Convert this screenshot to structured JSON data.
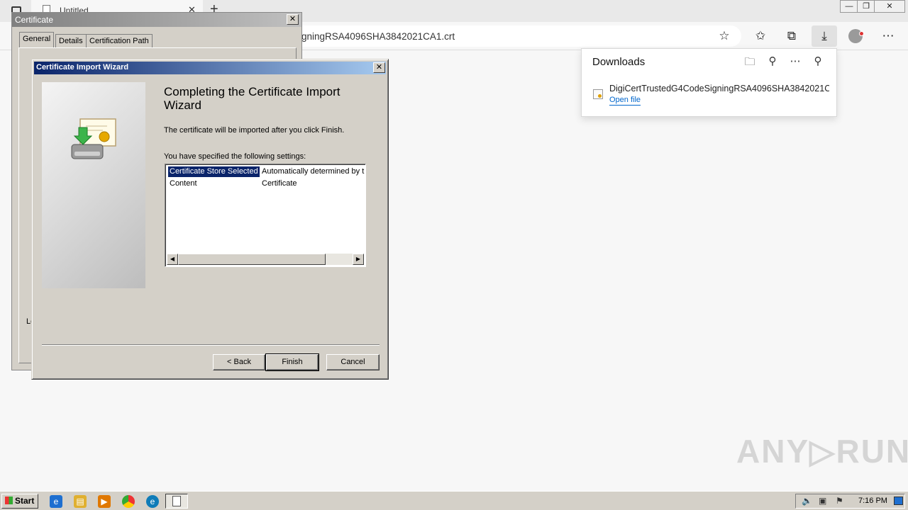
{
  "browser": {
    "tab_title": "Untitled",
    "tab_close": "✕",
    "new_tab": "+",
    "address": "igningRSA4096SHA3842021CA1.crt",
    "window_controls": [
      "—",
      "❐",
      "✕"
    ]
  },
  "downloads": {
    "title": "Downloads",
    "file_name": "DigiCertTrustedG4CodeSigningRSA4096SHA3842021C...",
    "open_file": "Open file"
  },
  "certificate_dialog": {
    "title": "Certificate",
    "close": "✕",
    "tabs": [
      "General",
      "Details",
      "Certification Path"
    ],
    "partial_text": "Le"
  },
  "wizard": {
    "title": "Certificate Import Wizard",
    "close": "✕",
    "heading": "Completing the Certificate Import Wizard",
    "text1": "The certificate will be imported after you click Finish.",
    "text2": "You have specified the following settings:",
    "settings": [
      {
        "name": "Certificate Store Selected",
        "value": "Automatically determined by t"
      },
      {
        "name": "Content",
        "value": "Certificate"
      }
    ],
    "scroll_left": "◀",
    "scroll_right": "▶",
    "buttons": {
      "back": "< Back",
      "finish": "Finish",
      "cancel": "Cancel"
    }
  },
  "taskbar": {
    "start": "Start",
    "clock": "7:16 PM"
  },
  "watermark": "ANY▷RUN"
}
